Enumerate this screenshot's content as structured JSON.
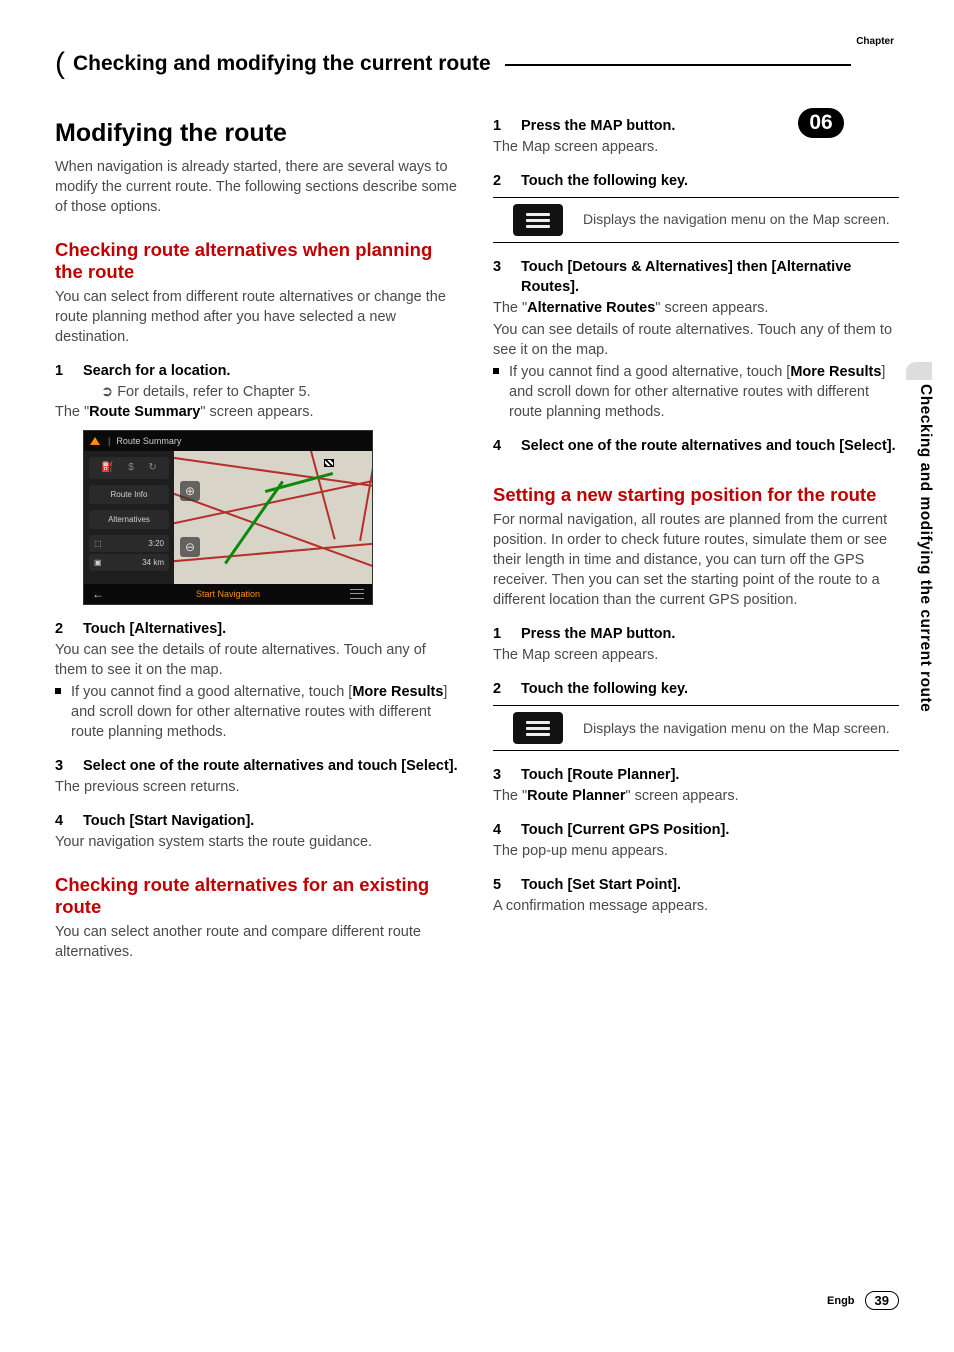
{
  "header": {
    "chapter_label": "Chapter",
    "title": "Checking and modifying the current route",
    "chapter_number": "06"
  },
  "side_text": "Checking and modifying the current route",
  "footer": {
    "lang": "Engb",
    "page": "39"
  },
  "left": {
    "h1": "Modifying the route",
    "intro": "When navigation is already started, there are several ways to modify the current route. The following sections describe some of those options.",
    "sec1": {
      "title": "Checking route alternatives when planning the route",
      "intro": "You can select from different route alternatives or change the route planning method after you have selected a new destination.",
      "step1": "Search for a location.",
      "step1_sub": "For details, refer to Chapter 5.",
      "step1_after_pre": "The \"",
      "step1_after_b": "Route Summary",
      "step1_after_post": "\" screen appears.",
      "screenshot": {
        "top": "Route Summary",
        "btn_route_info": "Route Info",
        "btn_alternatives": "Alternatives",
        "time": "3:20",
        "dist": "34 km",
        "bottom": "Start Navigation"
      },
      "step2": "Touch [Alternatives].",
      "step2_body1": "You can see the details of route alternatives. Touch any of them to see it on the map.",
      "step2_bullet_pre": "If you cannot find a good alternative, touch [",
      "step2_bullet_b": "More Results",
      "step2_bullet_post": "] and scroll down for other alternative routes with different route planning methods.",
      "step3": "Select one of the route alternatives and touch [Select].",
      "step3_body": "The previous screen returns.",
      "step4": "Touch [Start Navigation].",
      "step4_body": "Your navigation system starts the route guidance."
    },
    "sec2": {
      "title": "Checking route alternatives for an existing route",
      "intro": "You can select another route and compare different route alternatives."
    }
  },
  "right": {
    "sec2_cont": {
      "step1": "Press the MAP button.",
      "step1_body": "The Map screen appears.",
      "step2": "Touch the following key.",
      "key_desc": "Displays the navigation menu on the Map screen.",
      "step3": "Touch [Detours & Alternatives] then [Alternative Routes].",
      "step3_body_pre": "The \"",
      "step3_body_b": "Alternative Routes",
      "step3_body_post": "\" screen appears.",
      "step3_body2": "You can see details of route alternatives. Touch any of them to see it on the map.",
      "step3_bullet_pre": "If you cannot find a good alternative, touch [",
      "step3_bullet_b": "More Results",
      "step3_bullet_post": "] and scroll down for other alternative routes with different route planning methods.",
      "step4": "Select one of the route alternatives and touch [Select]."
    },
    "sec3": {
      "title": "Setting a new starting position for the route",
      "intro": "For normal navigation, all routes are planned from the current position. In order to check future routes, simulate them or see their length in time and distance, you can turn off the GPS receiver. Then you can set the starting point of the route to a different location than the current GPS position.",
      "step1": "Press the MAP button.",
      "step1_body": "The Map screen appears.",
      "step2": "Touch the following key.",
      "key_desc": "Displays the navigation menu on the Map screen.",
      "step3": "Touch [Route Planner].",
      "step3_body_pre": "The \"",
      "step3_body_b": "Route Planner",
      "step3_body_post": "\" screen appears.",
      "step4": "Touch [Current GPS Position].",
      "step4_body": "The pop-up menu appears.",
      "step5": "Touch [Set Start Point].",
      "step5_body": "A confirmation message appears."
    }
  }
}
